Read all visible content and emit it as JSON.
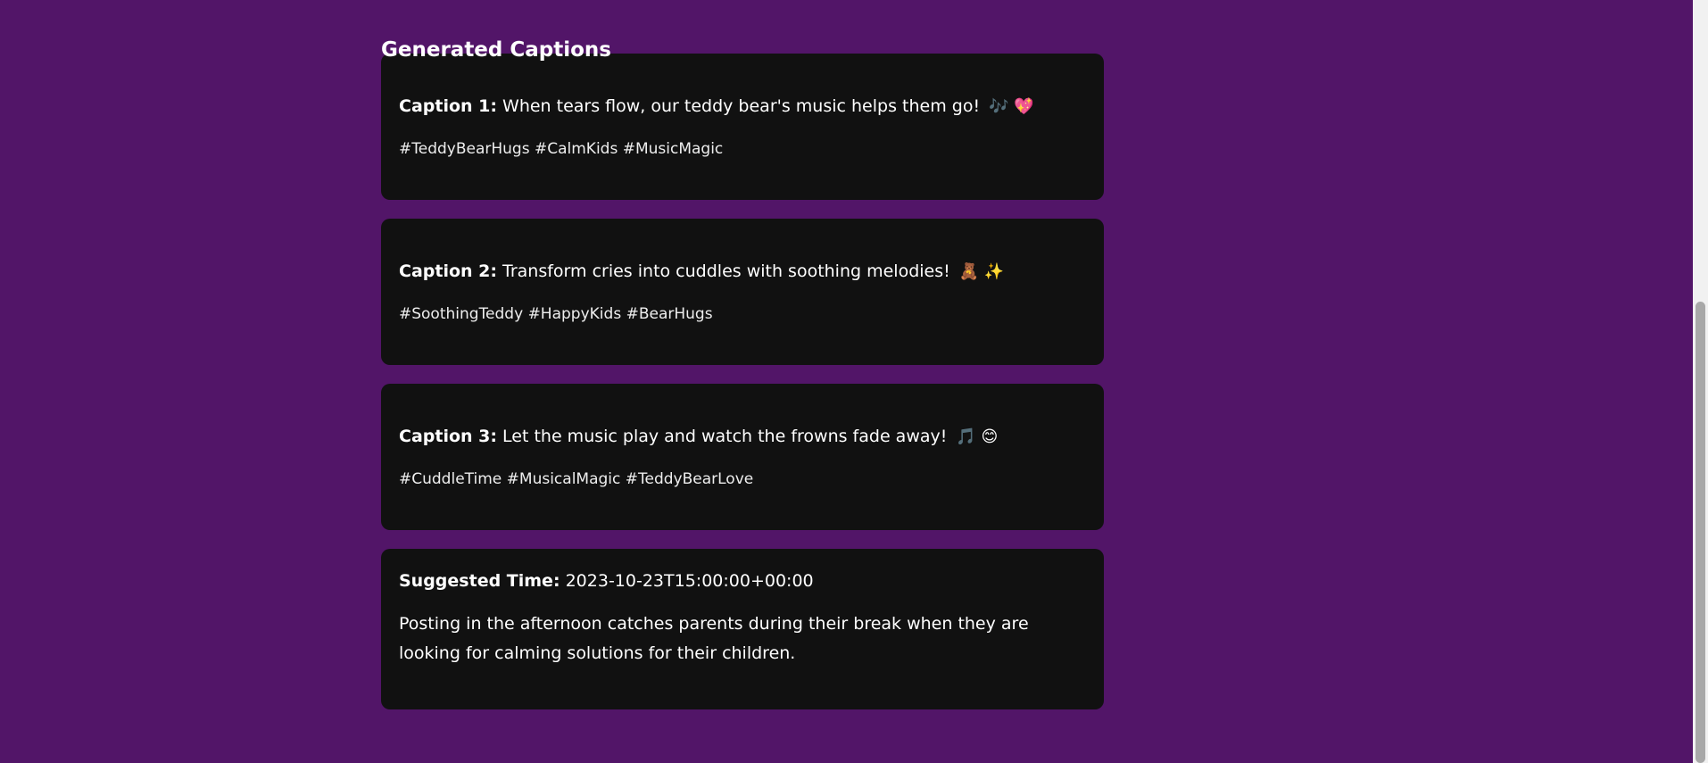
{
  "section": {
    "title": "Generated Captions"
  },
  "captions": [
    {
      "label": "Caption 1:",
      "text": "When tears flow, our teddy bear's music helps them go!",
      "emojis": "🎶 💖",
      "hashtags": "#TeddyBearHugs #CalmKids #MusicMagic"
    },
    {
      "label": "Caption 2:",
      "text": "Transform cries into cuddles with soothing melodies!",
      "emojis": "🧸 ✨",
      "hashtags": "#SoothingTeddy #HappyKids #BearHugs"
    },
    {
      "label": "Caption 3:",
      "text": "Let the music play and watch the frowns fade away!",
      "emojis": "🎵 😊",
      "hashtags": "#CuddleTime #MusicalMagic #TeddyBearLove"
    }
  ],
  "suggestion": {
    "label": "Suggested Time:",
    "time": "2023-10-23T15:00:00+00:00",
    "description": "Posting in the afternoon catches parents during their break when they are looking for calming solutions for their children."
  },
  "colors": {
    "background": "#521568",
    "card": "#111111",
    "text": "#ffffff"
  }
}
